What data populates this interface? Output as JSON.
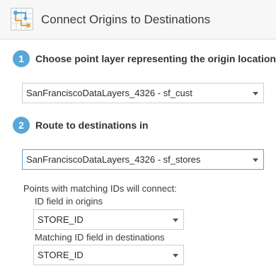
{
  "header": {
    "title": "Connect Origins to Destinations",
    "icon": "connect-origins-destinations-icon"
  },
  "step1": {
    "number": "1",
    "label": "Choose point layer representing the origin locations:",
    "select_value": "SanFranciscoDataLayers_4326 - sf_cust"
  },
  "step2": {
    "number": "2",
    "label": "Route to destinations in",
    "select_value": "SanFranciscoDataLayers_4326 - sf_stores"
  },
  "matching": {
    "intro": "Points with matching IDs will connect:",
    "origins_label": "ID field in origins",
    "origins_value": "STORE_ID",
    "destinations_label": "Matching ID field in destinations",
    "destinations_value": "STORE_ID"
  },
  "colors": {
    "accent": "#59a6d9",
    "header_bg": "#f7f7f7"
  }
}
